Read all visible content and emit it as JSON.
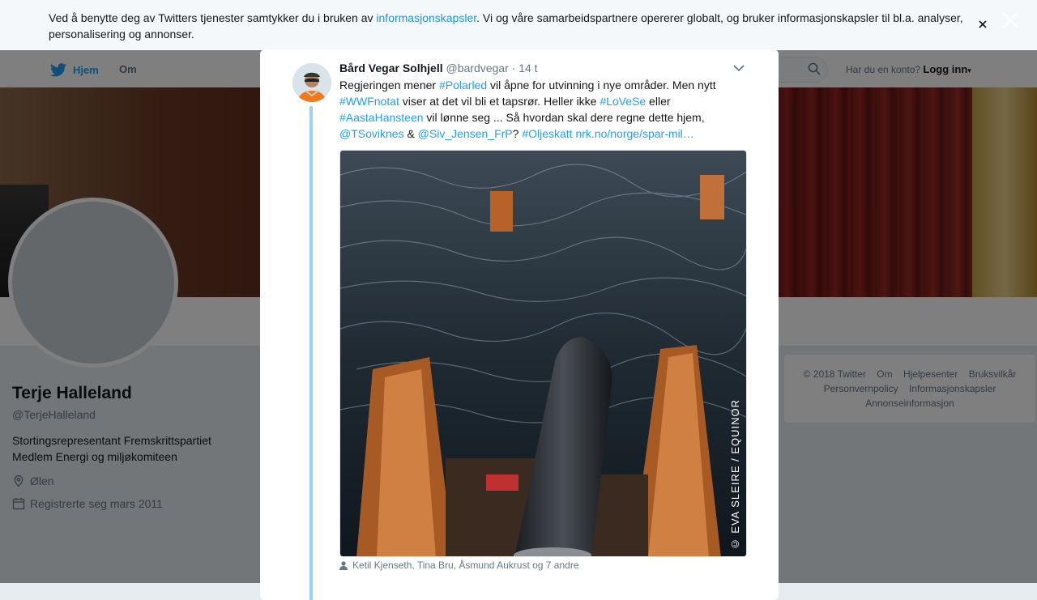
{
  "cookie_banner": {
    "text_before_link": "Ved å benytte deg av Twitters tjenester samtykker du i bruken av ",
    "link_text": "informasjonskapsler",
    "text_after_link": ". Vi og våre samarbeidspartnere opererer globalt, og bruker informasjonskapsler til bl.a. analyser, personalisering og annonser."
  },
  "topnav": {
    "home_label": "Hjem",
    "about_label": "Om",
    "account_question": "Har du en konto?",
    "login_label": "Logg inn"
  },
  "profile": {
    "name": "Terje Halleland",
    "handle": "@TerjeHalleland",
    "bio_line1": "Stortingsrepresentant Fremskrittspartiet",
    "bio_line2": "Medlem Energi og miljøkomiteen",
    "location": "Ølen",
    "joined": "Registrerte seg mars 2011"
  },
  "footer": {
    "row1": [
      "© 2018 Twitter",
      "Om",
      "Hjelpesenter",
      "Bruksvilkår"
    ],
    "row2": [
      "Personvernpolicy",
      "Informasjonskapsler"
    ],
    "row3": [
      "Annonseinformasjon"
    ]
  },
  "tweet": {
    "author_name": "Bård Vegar Solhjell",
    "author_handle": "@bardvegar",
    "time": "· 14 t",
    "text": {
      "p1": "Regjeringen mener ",
      "tag_polarled": "#Polarled",
      "p2": " vil åpne for utvinning i nye områder. Men nytt ",
      "tag_wwf": "#WWFnotat",
      "p3": " viser at det vil bli et tapsrør. Heller ikke ",
      "tag_lovese": "#LoVeSe",
      "p4": " eller ",
      "tag_aasta": "#AastaHansteen",
      "p5": " vil lønne seg ... Så hvordan skal dere regne dette hjem, ",
      "mention_tsoviknes": "@TSoviknes",
      "p6": " & ",
      "mention_siv": "@Siv_Jensen_FrP",
      "p7": "? ",
      "tag_oljeskatt": "#Oljeskatt",
      "p8": " ",
      "link": "nrk.no/norge/spar-mil…"
    },
    "photo_credit": "© EVA SLEIRE / EQUINOR",
    "tagged_people": "Ketil Kjenseth, Tina Bru, Åsmund Aukrust og 7 andre"
  },
  "colors": {
    "accent": "#1da1f2",
    "thread_line": "#9ed1f5",
    "muted": "#657786"
  }
}
